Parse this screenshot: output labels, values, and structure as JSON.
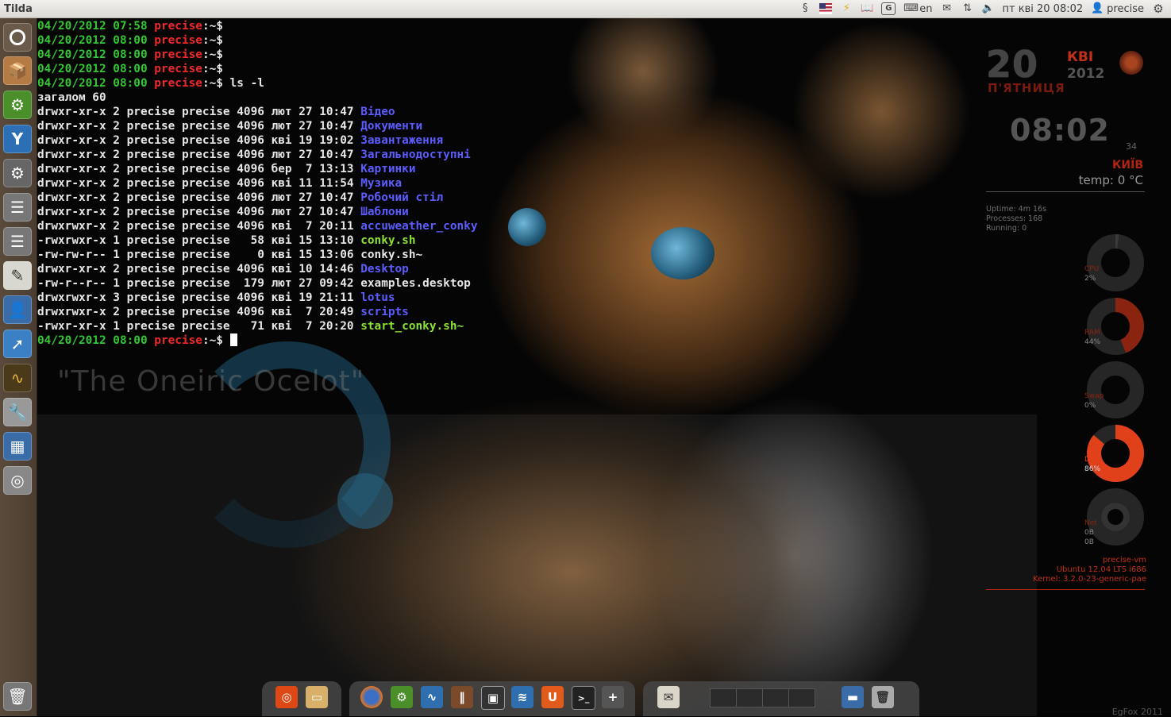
{
  "top_panel": {
    "app_title": "Tilda",
    "keyboard_layout": "en",
    "datetime": "пт кві 20 08:02",
    "user": "precise",
    "icons": [
      "ubuntuone-icon",
      "flag-us-icon",
      "power-icon",
      "book-icon",
      "gnome-do-icon",
      "keyboard-icon",
      "mail-icon",
      "network-icon",
      "volume-icon",
      "user-icon",
      "gear-icon"
    ]
  },
  "launcher": {
    "items": [
      "dash-home",
      "installer",
      "synaptic",
      "y-ppa-manager",
      "system-settings",
      "mixer",
      "mixer-2",
      "text-editor",
      "contacts",
      "pointer",
      "system-monitor",
      "tools",
      "workspace-switcher",
      "disc-burner"
    ],
    "trash": "trash"
  },
  "terminal": {
    "prompt_lines": [
      {
        "date": "04/20/2012 07:58",
        "host": "precise",
        "path": ":~$",
        "cmd": ""
      },
      {
        "date": "04/20/2012 08:00",
        "host": "precise",
        "path": ":~$",
        "cmd": ""
      },
      {
        "date": "04/20/2012 08:00",
        "host": "precise",
        "path": ":~$",
        "cmd": ""
      },
      {
        "date": "04/20/2012 08:00",
        "host": "precise",
        "path": ":~$",
        "cmd": ""
      },
      {
        "date": "04/20/2012 08:00",
        "host": "precise",
        "path": ":~$",
        "cmd": " ls -l"
      }
    ],
    "total": "загалом 60",
    "listing": [
      {
        "meta": "drwxr-xr-x 2 precise precise 4096 лют 27 10:47 ",
        "name": "Відео",
        "kind": "dir"
      },
      {
        "meta": "drwxr-xr-x 2 precise precise 4096 лют 27 10:47 ",
        "name": "Документи",
        "kind": "dir"
      },
      {
        "meta": "drwxr-xr-x 2 precise precise 4096 кві 19 19:02 ",
        "name": "Завантаження",
        "kind": "dir"
      },
      {
        "meta": "drwxr-xr-x 2 precise precise 4096 лют 27 10:47 ",
        "name": "Загальнодоступні",
        "kind": "dir"
      },
      {
        "meta": "drwxr-xr-x 2 precise precise 4096 бер  7 13:13 ",
        "name": "Картинки",
        "kind": "dir"
      },
      {
        "meta": "drwxr-xr-x 2 precise precise 4096 кві 11 11:54 ",
        "name": "Музика",
        "kind": "dir"
      },
      {
        "meta": "drwxr-xr-x 2 precise precise 4096 лют 27 10:47 ",
        "name": "Робочий стіл",
        "kind": "dir"
      },
      {
        "meta": "drwxr-xr-x 2 precise precise 4096 лют 27 10:47 ",
        "name": "Шаблони",
        "kind": "dir"
      },
      {
        "meta": "drwxrwxr-x 2 precise precise 4096 кві  7 20:11 ",
        "name": "accuweather_conky",
        "kind": "dir"
      },
      {
        "meta": "-rwxrwxr-x 1 precise precise   58 кві 15 13:10 ",
        "name": "conky.sh",
        "kind": "exec"
      },
      {
        "meta": "-rw-rw-r-- 1 precise precise    0 кві 15 13:06 ",
        "name": "conky.sh~",
        "kind": "file"
      },
      {
        "meta": "drwxr-xr-x 2 precise precise 4096 кві 10 14:46 ",
        "name": "Desktop",
        "kind": "dir"
      },
      {
        "meta": "-rw-r--r-- 1 precise precise  179 лют 27 09:42 ",
        "name": "examples.desktop",
        "kind": "file"
      },
      {
        "meta": "drwxrwxr-x 3 precise precise 4096 кві 19 21:11 ",
        "name": "lotus",
        "kind": "dir"
      },
      {
        "meta": "drwxrwxr-x 2 precise precise 4096 кві  7 20:49 ",
        "name": "scripts",
        "kind": "dir"
      },
      {
        "meta": "-rwxr-xr-x 1 precise precise   71 кві  7 20:20 ",
        "name": "start_conky.sh~",
        "kind": "exec"
      }
    ],
    "last_prompt": {
      "date": "04/20/2012 08:00",
      "host": "precise",
      "path": ":~$ "
    }
  },
  "wallpaper": {
    "title": "\"The Oneiric Ocelot\""
  },
  "conky": {
    "day": "20",
    "month": "КВІ",
    "year": "2012",
    "weekday": "П'ЯТНИЦЯ",
    "time": "08:02",
    "seconds": "34",
    "city": "КИЇВ",
    "temp": "temp: 0 °C",
    "uptime": "Uptime: 4m 16s",
    "processes": "Processes: 168",
    "running": "Running: 0",
    "gauges": [
      {
        "label": "CPU",
        "value": "2%",
        "fraction": 0.02
      },
      {
        "label": "RAM",
        "value": "44%",
        "fraction": 0.44
      },
      {
        "label": "Swap",
        "value": "0%",
        "fraction": 0.0
      },
      {
        "label": "Disk",
        "value": "86%",
        "fraction": 0.86
      },
      {
        "label": "Net",
        "value": "0B",
        "value2": "0B",
        "fraction": 0.0
      }
    ],
    "hostname": "precise-vm",
    "release": "Ubuntu 12.04 LTS  i686",
    "kernel": "Kernel: 3.2.0-23-generic-pae"
  },
  "dock": {
    "items": [
      "ubuntu-icon",
      "folder-icon",
      "firefox-icon",
      "synaptic-icon",
      "system-monitor-icon",
      "books-icon",
      "tilda-icon",
      "network-icon",
      "ubuntuone-icon",
      "terminal-icon",
      "add-icon",
      "mail-icon",
      "workspace-pager",
      "desktop-icon",
      "trash-icon"
    ]
  },
  "watermark": "EgFox 2011"
}
